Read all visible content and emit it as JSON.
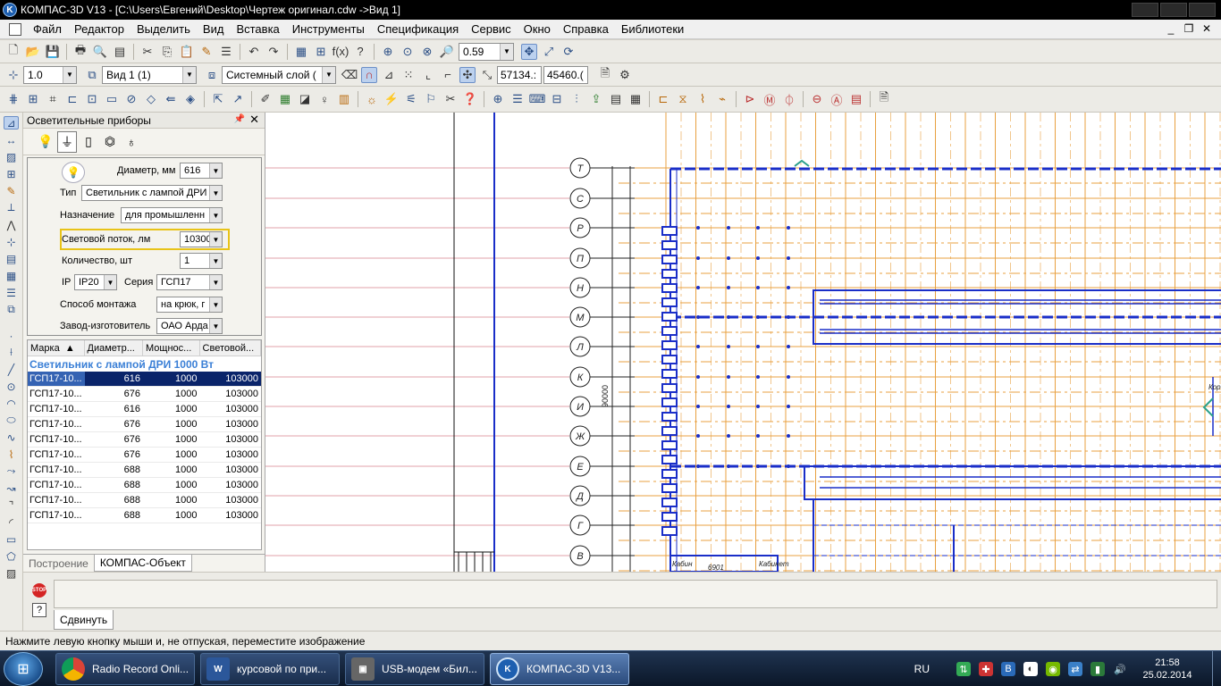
{
  "window": {
    "title": "КОМПАС-3D V13 - [C:\\Users\\Евгений\\Desktop\\Чертеж оригинал.cdw ->Вид 1]",
    "app_icon": "kompas-logo-icon"
  },
  "menu": [
    "Файл",
    "Редактор",
    "Выделить",
    "Вид",
    "Вставка",
    "Инструменты",
    "Спецификация",
    "Сервис",
    "Окно",
    "Справка",
    "Библиотеки"
  ],
  "toolbar1": {
    "zoom": "0.59"
  },
  "toolbar2": {
    "step": "1.0",
    "view": "Вид 1 (1)",
    "layer": "Системный слой (",
    "coord_x": "57134.:",
    "coord_y": "45460.("
  },
  "panel": {
    "title": "Осветительные приборы",
    "form": {
      "diameter_label": "Диаметр, мм",
      "diameter_value": "616",
      "type_label": "Тип",
      "type_value": "Светильник с лампой ДРИ",
      "purpose_label": "Назначение",
      "purpose_value": "для промышленн",
      "flux_label": "Световой поток, лм",
      "flux_value": "10300(",
      "qty_label": "Количество, шт",
      "qty_value": "1",
      "ip_label": "IP",
      "ip_value": "IP20",
      "series_label": "Серия",
      "series_value": "ГСП17",
      "mount_label": "Способ монтажа",
      "mount_value": "на крюк, г",
      "maker_label": "Завод-изготовитель",
      "maker_value": "ОАО Арда"
    },
    "table": {
      "columns": [
        "Марка",
        "Диаметр...",
        "Мощнос...",
        "Световой..."
      ],
      "group": "Светильник с лампой ДРИ 1000 Вт",
      "rows": [
        [
          "ГСП17-10...",
          "616",
          "1000",
          "103000"
        ],
        [
          "ГСП17-10...",
          "676",
          "1000",
          "103000"
        ],
        [
          "ГСП17-10...",
          "616",
          "1000",
          "103000"
        ],
        [
          "ГСП17-10...",
          "676",
          "1000",
          "103000"
        ],
        [
          "ГСП17-10...",
          "676",
          "1000",
          "103000"
        ],
        [
          "ГСП17-10...",
          "676",
          "1000",
          "103000"
        ],
        [
          "ГСП17-10...",
          "688",
          "1000",
          "103000"
        ],
        [
          "ГСП17-10...",
          "688",
          "1000",
          "103000"
        ],
        [
          "ГСП17-10...",
          "688",
          "1000",
          "103000"
        ],
        [
          "ГСП17-10...",
          "688",
          "1000",
          "103000"
        ]
      ]
    },
    "tabs": [
      "Построение",
      "КОМПАС-Объект"
    ]
  },
  "drawing": {
    "axis_letters": [
      "Т",
      "С",
      "Р",
      "П",
      "Н",
      "М",
      "Л",
      "К",
      "И",
      "Ж",
      "Е",
      "Д",
      "Г",
      "В"
    ],
    "dimension_text": "90000",
    "labels": [
      "Кабин",
      "Кабинет",
      "Кори",
      "6901"
    ]
  },
  "bottom": {
    "stop_label": "STOP",
    "help_label": "?",
    "tab": "Сдвинуть"
  },
  "status": "Нажмите левую кнопку мыши и, не отпуская, переместите изображение",
  "taskbar": {
    "tasks": [
      "Radio Record Onli...",
      "курсовой по при...",
      "USB-модем «Бил...",
      "КОМПАС-3D V13..."
    ],
    "lang": "RU",
    "time": "21:58",
    "date": "25.02.2014"
  }
}
